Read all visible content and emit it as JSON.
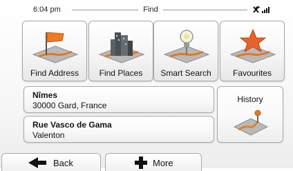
{
  "status": {
    "time": "6:04 pm",
    "title": "Find",
    "gps_icon": "gps-signal-icon"
  },
  "tiles": [
    {
      "label": "Find Address",
      "icon": "flag-on-map-icon"
    },
    {
      "label": "Find Places",
      "icon": "city-buildings-icon"
    },
    {
      "label": "Smart Search",
      "icon": "lightbulb-pin-icon"
    },
    {
      "label": "Favourites",
      "icon": "star-on-map-icon"
    }
  ],
  "recent": [
    {
      "name": "Nîmes",
      "detail": "30000 Gard, France"
    },
    {
      "name": "Rue Vasco de Gama",
      "detail": "Valenton"
    }
  ],
  "history": {
    "label": "History",
    "icon": "history-route-icon"
  },
  "nav": {
    "back_label": "Back",
    "more_label": "More"
  },
  "colors": {
    "accent": "#e07a1f",
    "star": "#e5632a",
    "frame": "#a9a9a9"
  }
}
